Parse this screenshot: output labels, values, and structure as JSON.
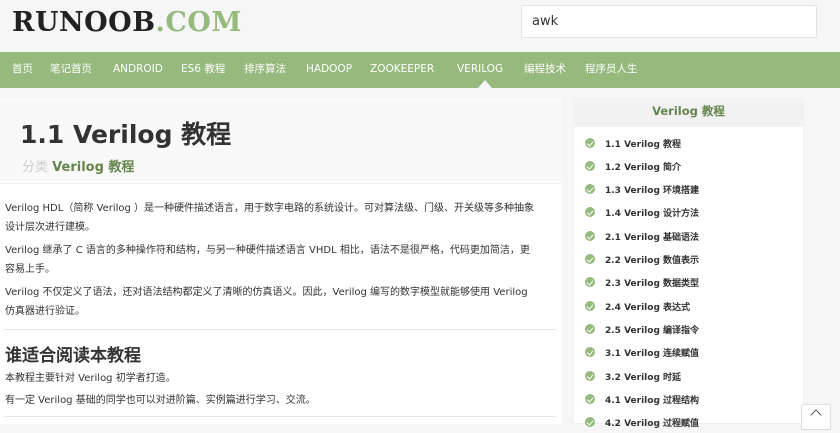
{
  "logo": {
    "part1": "RUNOOB",
    "part2": ".COM"
  },
  "search": {
    "value": "awk"
  },
  "nav": {
    "items": [
      "首页",
      "笔记首页",
      "ANDROID",
      "ES6 教程",
      "排序算法",
      "HADOOP",
      "ZOOKEEPER",
      "VERILOG",
      "编程技术",
      "程序员人生"
    ],
    "active": "VERILOG"
  },
  "article": {
    "title": "1.1 Verilog 教程",
    "category_label": "分类",
    "category_value": "Verilog 教程",
    "paragraphs": [
      "Verilog HDL（简称 Verilog ）是一种硬件描述语言，用于数字电路的系统设计。可对算法级、门级、开关级等多种抽象",
      "设计层次进行建模。",
      "Verilog 继承了 C 语言的多种操作符和结构，与另一种硬件描述语言 VHDL 相比，语法不是很严格，代码更加简洁，更",
      "容易上手。",
      "Verilog 不仅定义了语法，还对语法结构都定义了清晰的仿真语义。因此，Verilog 编写的数字模型就能够使用 Verilog",
      "仿真器进行验证。"
    ],
    "section_title": "谁适合阅读本教程",
    "section_paragraphs": [
      "本教程主要针对 Verilog 初学者打造。",
      "有一定 Verilog 基础的同学也可以对进阶篇、实例篇进行学习、交流。"
    ]
  },
  "sidebar": {
    "title": "Verilog 教程",
    "items": [
      "1.1 Verilog 教程",
      "1.2 Verilog 简介",
      "1.3 Verilog 环境搭建",
      "1.4 Verilog 设计方法",
      "2.1 Verilog 基础语法",
      "2.2 Verilog 数值表示",
      "2.3 Verilog 数据类型",
      "2.4 Verilog 表达式",
      "2.5 Verilog 编译指令",
      "3.1 Verilog 连续赋值",
      "3.2 Verilog 时延",
      "4.1 Verilog 过程结构",
      "4.2 Verilog 过程赋值"
    ]
  },
  "colors": {
    "brand_green": "#96b97d",
    "dark_green": "#64854c"
  }
}
